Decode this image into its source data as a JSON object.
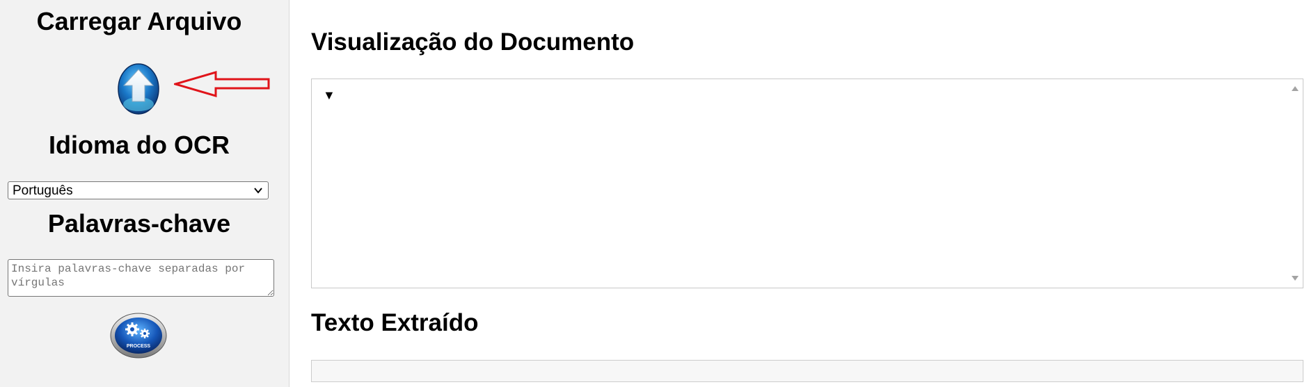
{
  "sidebar": {
    "upload_title": "Carregar Arquivo",
    "language_title": "Idioma do OCR",
    "language_selected": "Português",
    "keywords_title": "Palavras-chave",
    "keywords_placeholder": "Insira palavras-chave separadas por vírgulas",
    "process_label": "PROCESS",
    "upload_icon": "upload-arrow-icon",
    "process_icon": "gears-icon",
    "annotation_color": "#e0141a"
  },
  "main": {
    "preview_title": "Visualização do Documento",
    "preview_toggle": "▼",
    "extracted_title": "Texto Extraído"
  }
}
